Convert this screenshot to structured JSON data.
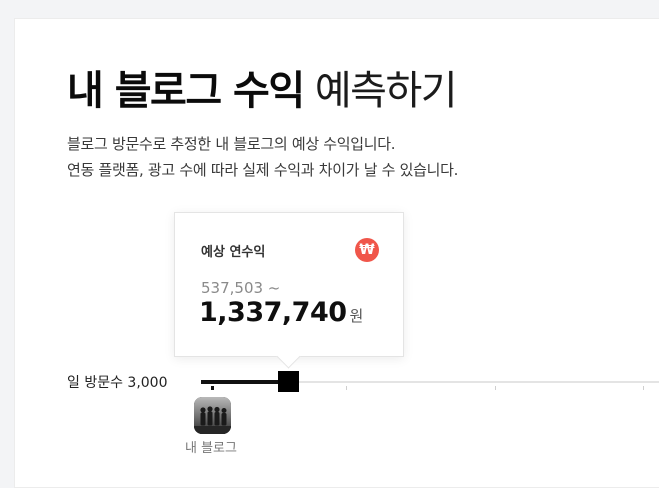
{
  "header": {
    "title_strong": "내 블로그 수익",
    "title_light": "예측하기"
  },
  "description": {
    "line1": "블로그 방문수로 추정한 내 블로그의 예상 수익입니다.",
    "line2": "연동 플랫폼, 광고 수에 따라 실제 수익과 차이가 날 수 있습니다."
  },
  "tooltip": {
    "label": "예상 연수익",
    "icon": "won-icon",
    "icon_glyph": "₩",
    "min_value": "537,503 ~",
    "max_value": "1,337,740",
    "unit": "원"
  },
  "slider": {
    "label": "일 방문수 3,000",
    "daily_visits": 3000
  },
  "blog": {
    "caption": "내 블로그"
  },
  "colors": {
    "accent": "#f0564a",
    "slider_fill": "#111111",
    "track": "#e4e4e4"
  }
}
